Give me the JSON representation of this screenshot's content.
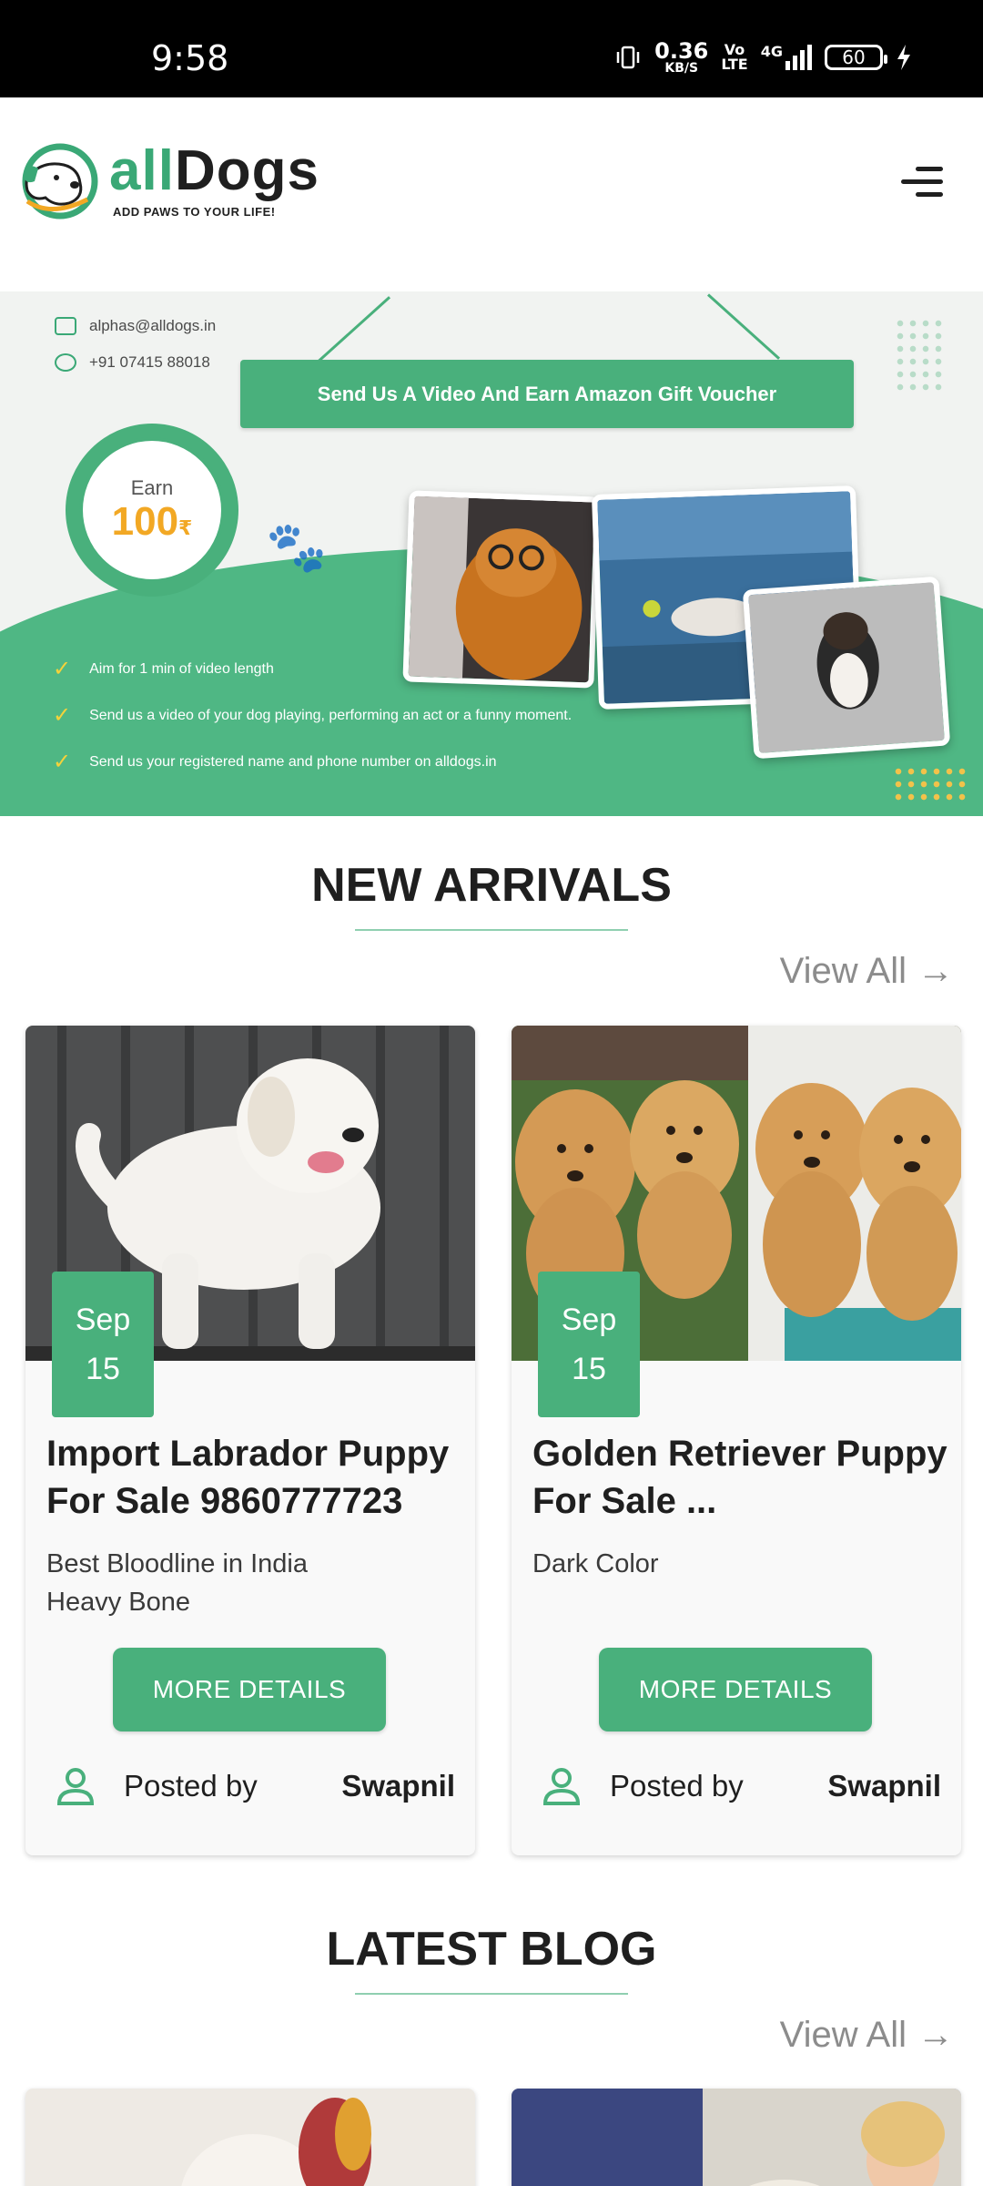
{
  "status_bar": {
    "time": "9:58",
    "speed_value": "0.36",
    "speed_unit": "KB/S",
    "volte_top": "Vo",
    "volte_bottom": "LTE",
    "network": "4G",
    "battery": "60"
  },
  "header": {
    "logo_name_part1": "all",
    "logo_name_part2": "Dogs",
    "logo_tagline": "ADD PAWS TO YOUR LIFE!",
    "menu_icon": "hamburger-menu-icon"
  },
  "banner": {
    "email": "alphas@alldogs.in",
    "phone": "+91 07415 88018",
    "title": "Send Us A Video And Earn Amazon Gift Voucher",
    "earn_label": "Earn",
    "earn_amount": "100",
    "earn_currency": "₹",
    "bullets": [
      "Aim for 1 min of video length",
      "Send us a video of your dog playing, performing an act or a funny moment.",
      "Send us your registered name and phone number on alldogs.in"
    ]
  },
  "new_arrivals": {
    "title": "NEW ARRIVALS",
    "view_all": "View All",
    "cards": [
      {
        "month": "Sep",
        "day": "15",
        "title": "Import Labrador Puppy For Sale 9860777723",
        "description": "Best Bloodline in India\nHeavy Bone",
        "button": "MORE DETAILS",
        "posted_by_label": "Posted by",
        "author": "Swapnil"
      },
      {
        "month": "Sep",
        "day": "15",
        "title": "Golden Retriever Puppy For Sale ...",
        "description": "Dark Color",
        "button": "MORE DETAILS",
        "posted_by_label": "Posted by",
        "author": "Swapnil"
      }
    ]
  },
  "latest_blog": {
    "title": "LATEST BLOG",
    "view_all": "View All"
  },
  "colors": {
    "brand_green": "#49b07c",
    "text_dark": "#1f1f1f",
    "muted": "#8c8c8c"
  }
}
